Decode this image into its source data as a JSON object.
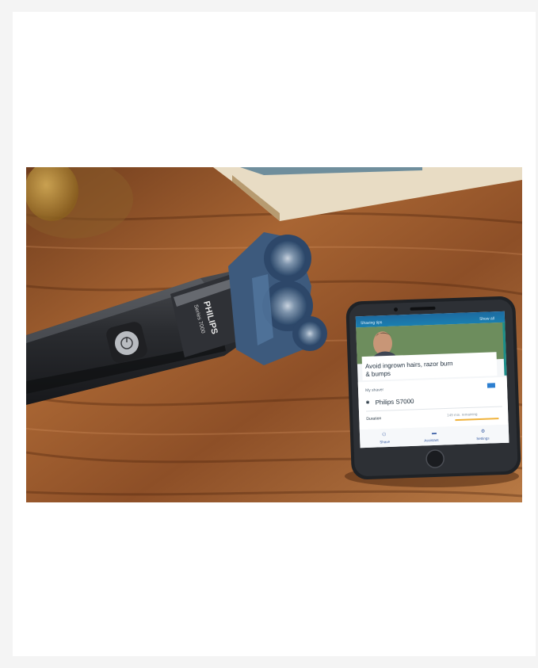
{
  "image": {
    "alt": "Philips shaver lying on a wooden table next to a smartphone running the shaving app",
    "colors": {
      "background": "#f4f4f4",
      "card": "#ffffff",
      "wood": "#8a4c24",
      "shaver_body": "#2b2d31",
      "shaver_heads": "#4b6f94",
      "app_accent": "#1a7fb0",
      "app_highlight": "#1c8e8a"
    },
    "shaver": {
      "brand": "PHILIPS",
      "model": "Series 7000"
    },
    "phone": {
      "header_left": "Shaving tips",
      "header_right": "Show all",
      "tip": {
        "line1": "Avoid ingrown hairs, razor burn",
        "line2": "& bumps"
      },
      "my_shaver_label": "My shaver",
      "device_name": "Philips S7000",
      "duration_label": "Duration",
      "duration_value": "149 min. remaining",
      "tabs": [
        "Shave",
        "Assistant",
        "Settings"
      ]
    }
  }
}
